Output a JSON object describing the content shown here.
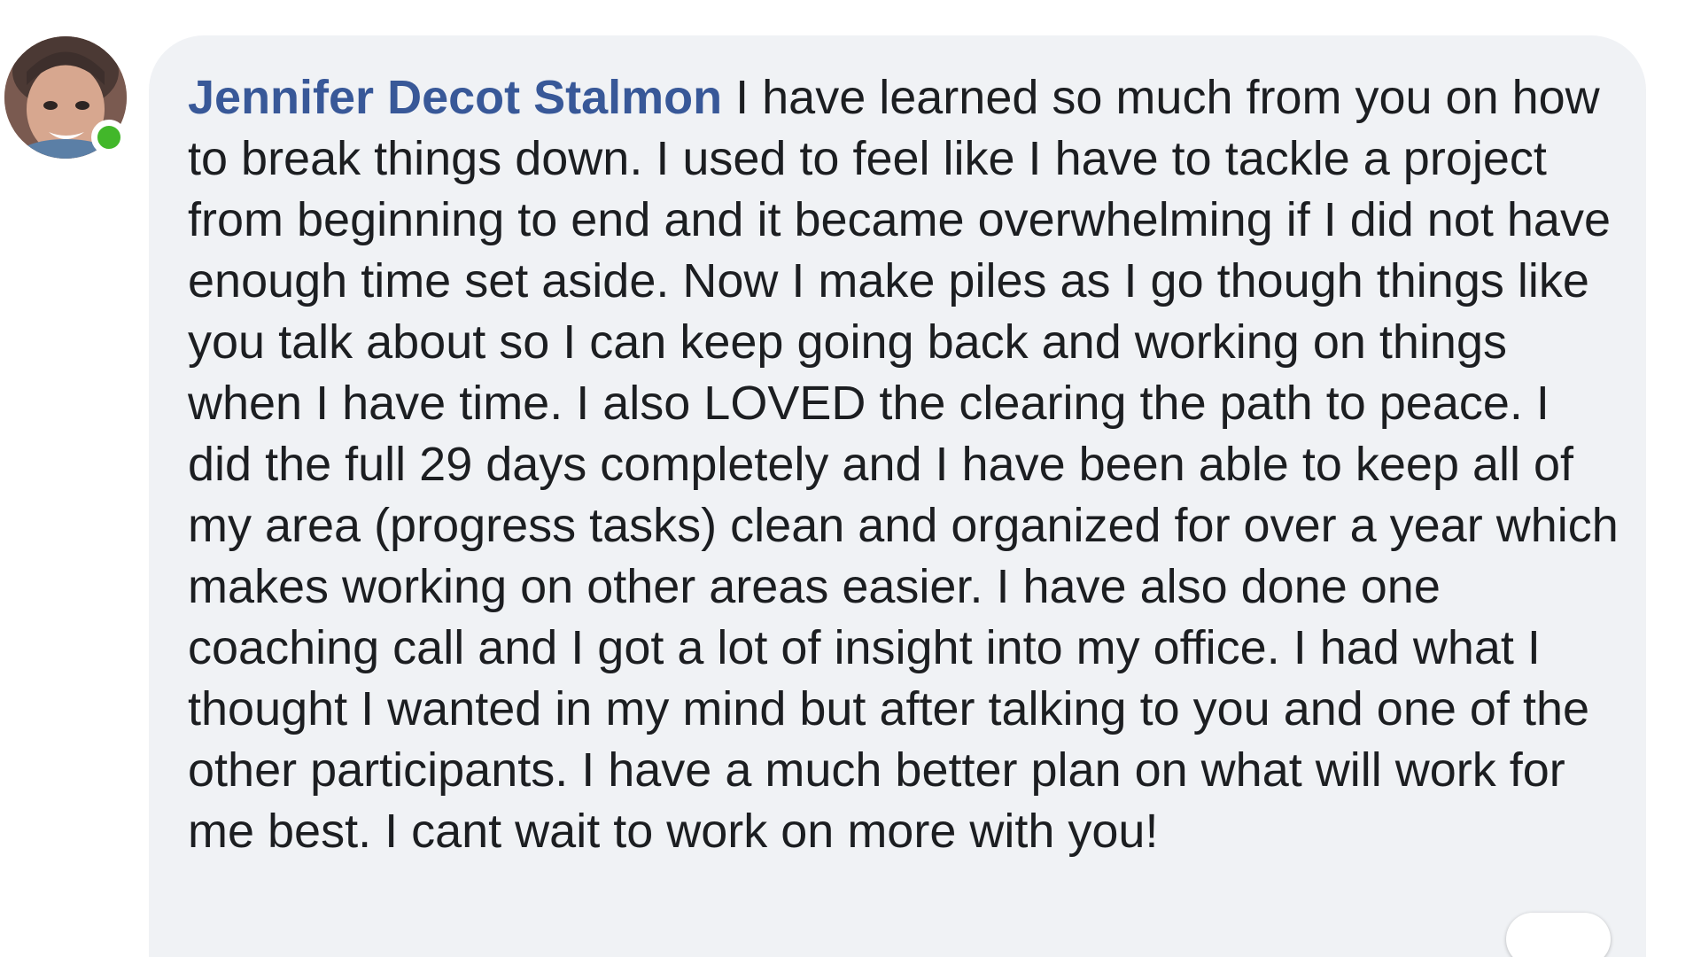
{
  "comment": {
    "author": "Jennifer Decot Stalmon",
    "text": "I have learned so much from you on how to break things down. I used to feel like I have to tackle a project from beginning to end and it became overwhelming if I did not have enough time set aside. Now I make piles as I go though things like you talk about so I can keep going back and working on things when I have time. I also LOVED the clearing the path to peace. I did the full 29 days completely and I have been able to keep all of my area (progress tasks) clean and organized for over a year which makes working on other areas easier. I have also done one coaching call and I got a lot of insight into my office. I had what I thought I wanted in my mind but after talking to you and one of the other participants. I have a much better plan on what will work for me best. I cant wait to work on more with you!",
    "presence_status": "online"
  },
  "colors": {
    "author_name": "#385898",
    "bubble_background": "#f0f2f5",
    "body_text": "#1c1e21",
    "presence_dot": "#42b72a"
  }
}
